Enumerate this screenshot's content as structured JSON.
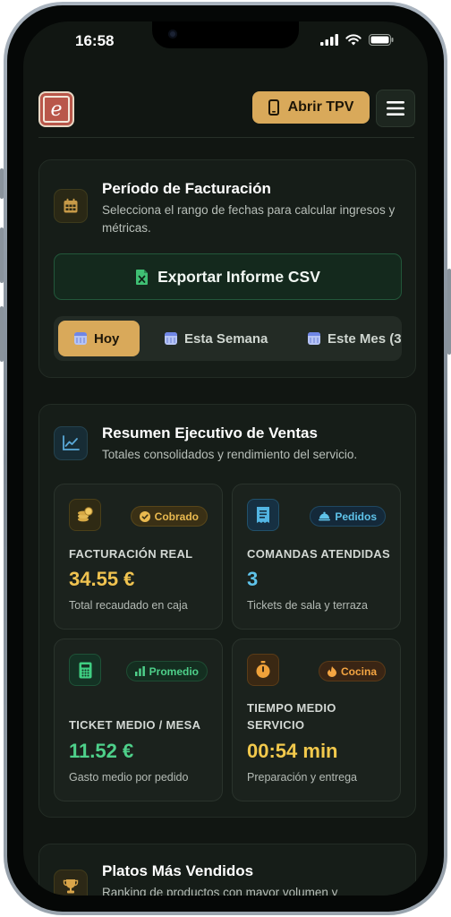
{
  "status_bar": {
    "time": "16:58"
  },
  "header": {
    "logo_letter": "e",
    "tpv_label": "Abrir TPV"
  },
  "billing": {
    "title": "Período de Facturación",
    "subtitle": "Selecciona el rango de fechas para calcular ingresos y métricas.",
    "export_label": "Exportar Informe CSV",
    "ranges": [
      "Hoy",
      "Esta Semana",
      "Este Mes (3"
    ],
    "selected_range": "Hoy"
  },
  "summary": {
    "title": "Resumen Ejecutivo de Ventas",
    "subtitle": "Totales consolidados y rendimiento del servicio.",
    "metrics": [
      {
        "badge": "Cobrado",
        "label": "FACTURACIÓN REAL",
        "value": "34.55 €",
        "note": "Total recaudado en caja",
        "accent": "#f0c350"
      },
      {
        "badge": "Pedidos",
        "label": "COMANDAS ATENDIDAS",
        "value": "3",
        "note": "Tickets de sala y terraza",
        "accent": "#5fc3ea"
      },
      {
        "badge": "Promedio",
        "label": "TICKET MEDIO / MESA",
        "value": "11.52 €",
        "note": "Gasto medio por pedido",
        "accent": "#4ed08a"
      },
      {
        "badge": "Cocina",
        "label": "TIEMPO MEDIO SERVICIO",
        "value": "00:54 min",
        "note": "Preparación y entrega",
        "accent": "#f2c94c"
      }
    ]
  },
  "top_dishes": {
    "title": "Platos Más Vendidos",
    "subtitle": "Ranking de productos con mayor volumen y"
  },
  "colors": {
    "background": "#111612",
    "card": "#161d18",
    "gold": "#d9a95a"
  }
}
